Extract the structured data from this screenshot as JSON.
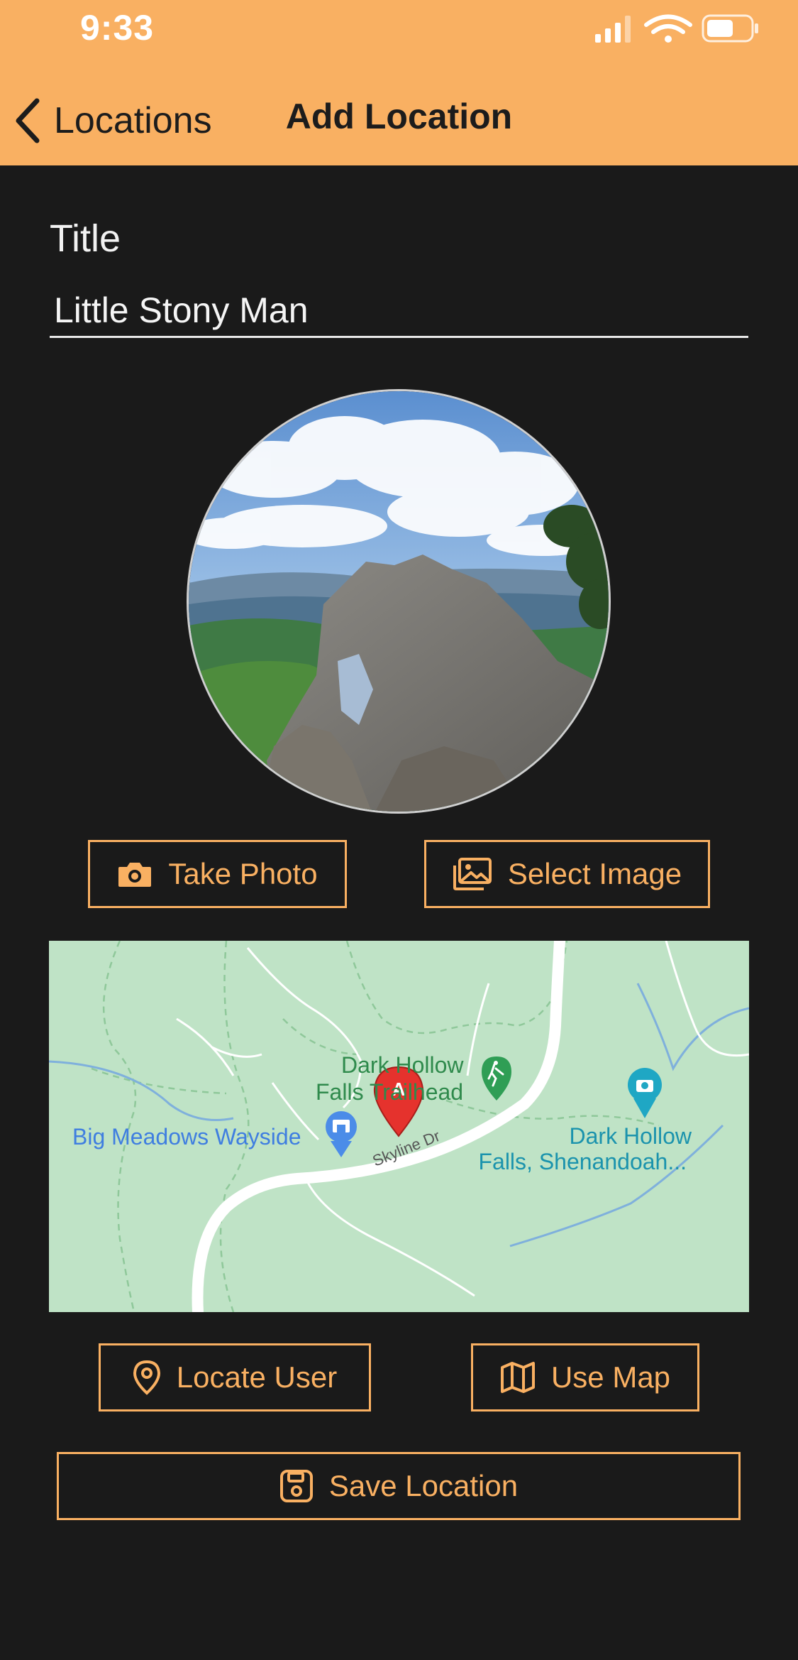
{
  "status_bar": {
    "time": "9:33"
  },
  "nav": {
    "back_label": "Locations",
    "title": "Add Location"
  },
  "form": {
    "title_label": "Title",
    "title_value": "Little Stony Man"
  },
  "buttons": {
    "take_photo": "Take Photo",
    "select_image": "Select Image",
    "locate_user": "Locate User",
    "use_map": "Use Map",
    "save_location": "Save Location"
  },
  "map": {
    "pin_label": "A",
    "place_big_meadows": "Big Meadows Wayside",
    "place_trailhead_line1": "Dark Hollow",
    "place_trailhead_line2": "Falls Trailhead",
    "place_falls_line1": "Dark Hollow",
    "place_falls_line2": "Falls, Shenandoah...",
    "road_label": "Skyline Dr"
  },
  "colors": {
    "accent": "#f9b062",
    "background": "#1a1a1a",
    "map_background": "#bfe3c6"
  }
}
